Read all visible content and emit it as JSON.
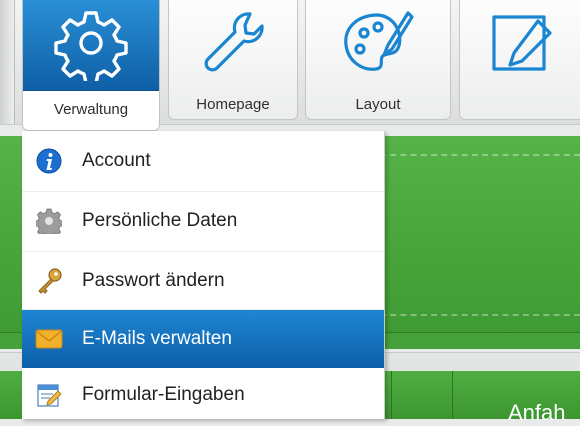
{
  "toolbar": {
    "tabs": [
      {
        "label": "Verwaltung",
        "icon": "gear-icon",
        "active": true
      },
      {
        "label": "Homepage",
        "icon": "wrench-icon",
        "active": false
      },
      {
        "label": "Layout",
        "icon": "palette-icon",
        "active": false
      },
      {
        "label": "",
        "icon": "edit-icon",
        "active": false
      }
    ]
  },
  "dropdown": {
    "items": [
      {
        "label": "Account",
        "icon": "info-icon",
        "selected": false
      },
      {
        "label": "Persönliche Daten",
        "icon": "gear-icon",
        "selected": false
      },
      {
        "label": "Passwort ändern",
        "icon": "key-icon",
        "selected": false
      },
      {
        "label": "E-Mails verwalten",
        "icon": "mail-icon",
        "selected": true
      },
      {
        "label": "Formular-Eingaben",
        "icon": "form-icon",
        "selected": false
      }
    ]
  },
  "content": {
    "partial_column_label": "Anfah"
  },
  "colors": {
    "accent_blue": "#1479c6",
    "green": "#4aa63d"
  }
}
